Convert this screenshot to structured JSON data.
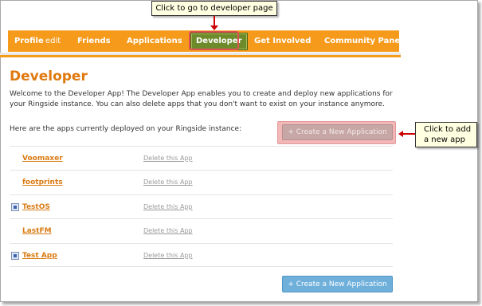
{
  "callouts": {
    "developer_page": "Click to go to developer page",
    "add_app": "Click to add a new app"
  },
  "nav": {
    "profile": "Profile",
    "edit": "edit",
    "friends": "Friends",
    "applications": "Applications",
    "developer": "Developer",
    "get_involved": "Get Involved",
    "community_panel": "Community Panel"
  },
  "main": {
    "title": "Developer",
    "intro": "Welcome to the Developer App! The Developer App enables you to create and deploy new applications for your Ringside instance. You can also delete apps that you don't want to exist on your instance anymore.",
    "deployed_label": "Here are the apps currently deployed on your Ringside instance:",
    "create_button": "+ Create a New Application",
    "delete_label": "Delete this App",
    "apps": [
      {
        "name": "Voomaxer",
        "icon": ""
      },
      {
        "name": "footprints",
        "icon": ""
      },
      {
        "name": "TestOS",
        "icon": "app-icon"
      },
      {
        "name": "LastFM",
        "icon": ""
      },
      {
        "name": "Test App",
        "icon": "app-icon"
      }
    ]
  },
  "colors": {
    "accent_orange": "#f59a1b",
    "active_tab": "#6e8b2c",
    "title": "#e07a10",
    "button_blue": "#6fb0db",
    "callout_bg": "#ffffe1",
    "arrow_red": "#cc0000"
  }
}
